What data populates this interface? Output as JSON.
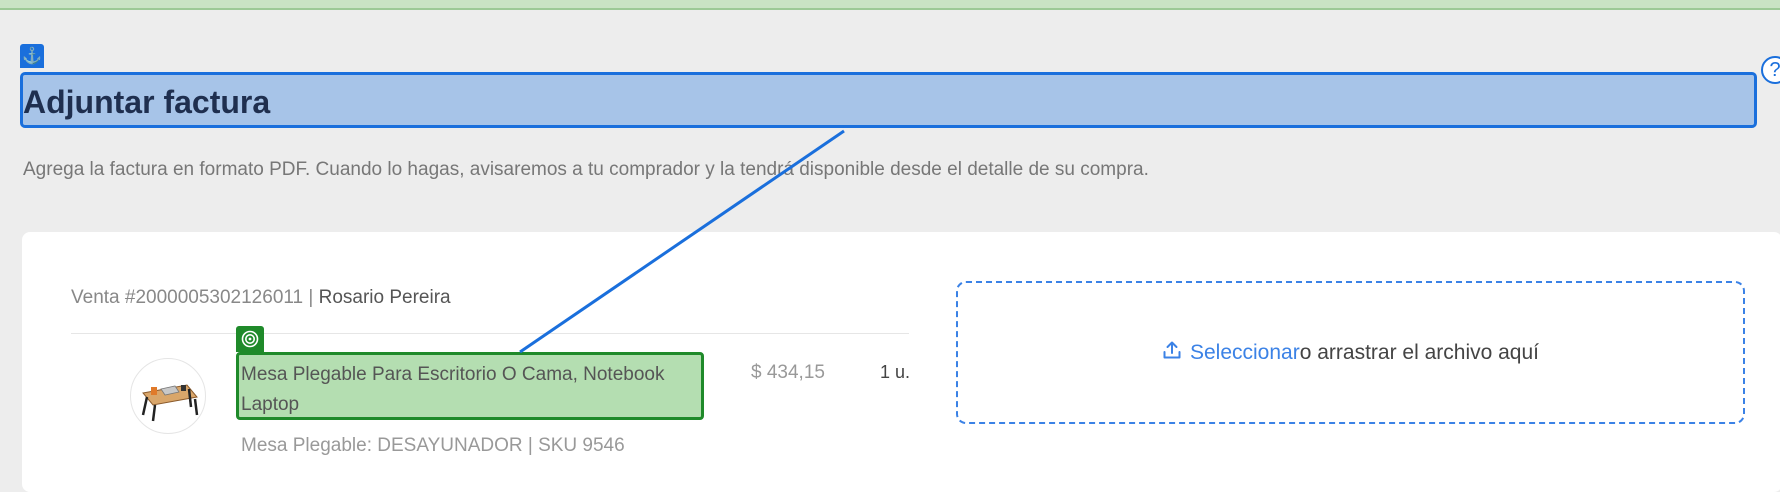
{
  "header": {
    "title": "Adjuntar factura",
    "subtitle": "Agrega la factura en formato PDF. Cuando lo hagas, avisaremos a tu comprador y la tendrá disponible desde el detalle de su compra."
  },
  "icons": {
    "anchor": "anchor-icon",
    "help": "help-icon",
    "target": "target-icon",
    "upload": "upload-icon"
  },
  "help_glyph": "?",
  "sale": {
    "label": "Venta #2000005302126011 | ",
    "buyer": "Rosario Pereira"
  },
  "product": {
    "title": "Mesa Plegable Para Escritorio O Cama, Notebook Laptop",
    "price": "$ 434,15",
    "quantity": "1 u.",
    "variant": "Mesa Plegable: DESAYUNADOR | SKU 9546"
  },
  "dropzone": {
    "link": "Seleccionar",
    "text": " o arrastrar el archivo aquí"
  },
  "colors": {
    "accent": "#1a6fdc",
    "highlight_blue": "#a7c4e8",
    "highlight_green": "#b4deb1",
    "green_border": "#1f8a2a",
    "link": "#3b82e6"
  }
}
